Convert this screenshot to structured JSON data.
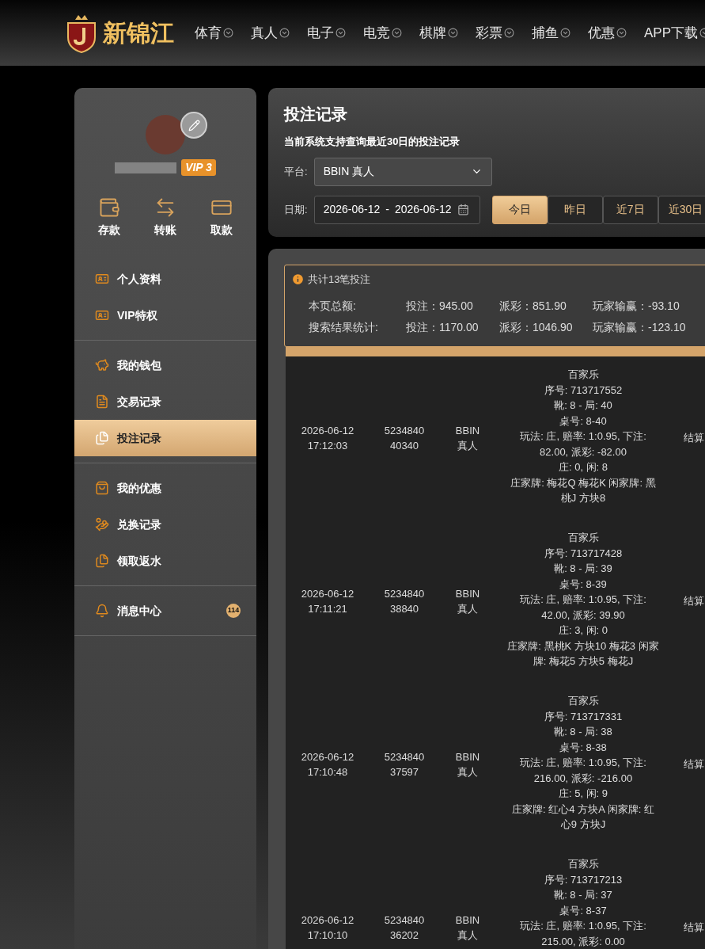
{
  "brand": {
    "name": "新锦江"
  },
  "nav": [
    {
      "label": "体育"
    },
    {
      "label": "真人"
    },
    {
      "label": "电子"
    },
    {
      "label": "电竞"
    },
    {
      "label": "棋牌"
    },
    {
      "label": "彩票"
    },
    {
      "label": "捕鱼"
    },
    {
      "label": "优惠"
    },
    {
      "label": "APP下载"
    }
  ],
  "profile": {
    "vip": "VIP 3"
  },
  "quick_actions": [
    {
      "kind": "wallet",
      "label": "存款"
    },
    {
      "kind": "transfer",
      "label": "转账"
    },
    {
      "kind": "card",
      "label": "取款"
    }
  ],
  "sidebar": {
    "groups": [
      {
        "items": [
          {
            "kind": "id",
            "label": "个人资料",
            "selected": false
          },
          {
            "kind": "id",
            "label": "VIP特权",
            "selected": false
          }
        ]
      },
      {
        "items": [
          {
            "kind": "piggy",
            "label": "我的钱包",
            "selected": false
          },
          {
            "kind": "doc",
            "label": "交易记录",
            "selected": false
          },
          {
            "kind": "docs",
            "label": "投注记录",
            "selected": true
          }
        ]
      },
      {
        "items": [
          {
            "kind": "bag",
            "label": "我的优惠",
            "selected": false
          },
          {
            "kind": "money",
            "label": "兑换记录",
            "selected": false
          },
          {
            "kind": "docs",
            "label": "领取返水",
            "selected": false
          }
        ]
      },
      {
        "items": [
          {
            "kind": "bell",
            "label": "消息中心",
            "selected": false,
            "badge": "114"
          }
        ]
      }
    ]
  },
  "filter": {
    "title": "投注记录",
    "note": "当前系统支持查询最近30日的投注记录",
    "platform_label": "平台:",
    "platform": "BBIN 真人",
    "date_label": "日期:",
    "date_from": "2026-06-12",
    "date_sep": "-",
    "date_to": "2026-06-12",
    "ranges": [
      {
        "label": "今日",
        "selected": true
      },
      {
        "label": "昨日",
        "selected": false
      },
      {
        "label": "近7日",
        "selected": false
      },
      {
        "label": "近30日",
        "selected": false
      }
    ]
  },
  "summary": {
    "title": "共计13笔投注",
    "rows": [
      {
        "label": "本页总额:",
        "bet": "投注：945.00",
        "payout": "派彩：851.90",
        "winloss": "玩家输赢：-93.10"
      },
      {
        "label": "搜索结果统计:",
        "bet": "投注：1170.00",
        "payout": "派彩：1046.90",
        "winloss": "玩家输赢：-123.10"
      }
    ]
  },
  "table": {
    "rows": [
      {
        "time": [
          "2026-06-12",
          "17:12:03"
        ],
        "order": [
          "5234840",
          "40340"
        ],
        "platform": [
          "BBIN",
          "真人"
        ],
        "details": [
          "百家乐",
          "序号: 713717552",
          "靴: 8 - 局: 40",
          "桌号: 8-40",
          "玩法: 庄, 赔率: 1:0.95, 下注:",
          "82.00, 派彩: -82.00",
          "庄: 0, 闲: 8",
          "庄家牌: 梅花Q 梅花K 闲家牌: 黑",
          "桃J 方块8"
        ],
        "column_5": "结算"
      },
      {
        "time": [
          "2026-06-12",
          "17:11:21"
        ],
        "order": [
          "5234840",
          "38840"
        ],
        "platform": [
          "BBIN",
          "真人"
        ],
        "details": [
          "百家乐",
          "序号: 713717428",
          "靴: 8 - 局: 39",
          "桌号: 8-39",
          "玩法: 庄, 赔率: 1:0.95, 下注:",
          "42.00, 派彩: 39.90",
          "庄: 3, 闲: 0",
          "庄家牌: 黑桃K 方块10 梅花3 闲家",
          "牌: 梅花5 方块5 梅花J"
        ],
        "column_5": "结算"
      },
      {
        "time": [
          "2026-06-12",
          "17:10:48"
        ],
        "order": [
          "5234840",
          "37597"
        ],
        "platform": [
          "BBIN",
          "真人"
        ],
        "details": [
          "百家乐",
          "序号: 713717331",
          "靴: 8 - 局: 38",
          "桌号: 8-38",
          "玩法: 庄, 赔率: 1:0.95, 下注:",
          "216.00, 派彩: -216.00",
          "庄: 5, 闲: 9",
          "庄家牌: 红心4 方块A 闲家牌: 红",
          "心9 方块J"
        ],
        "column_5": "结算"
      },
      {
        "time": [
          "2026-06-12",
          "17:10:10"
        ],
        "order": [
          "5234840",
          "36202"
        ],
        "platform": [
          "BBIN",
          "真人"
        ],
        "details": [
          "百家乐",
          "序号: 713717213",
          "靴: 8 - 局: 37",
          "桌号: 8-37",
          "玩法: 庄, 赔率: 1:0.95, 下注:",
          "215.00, 派彩: 0.00"
        ],
        "column_5": "结算"
      }
    ]
  }
}
